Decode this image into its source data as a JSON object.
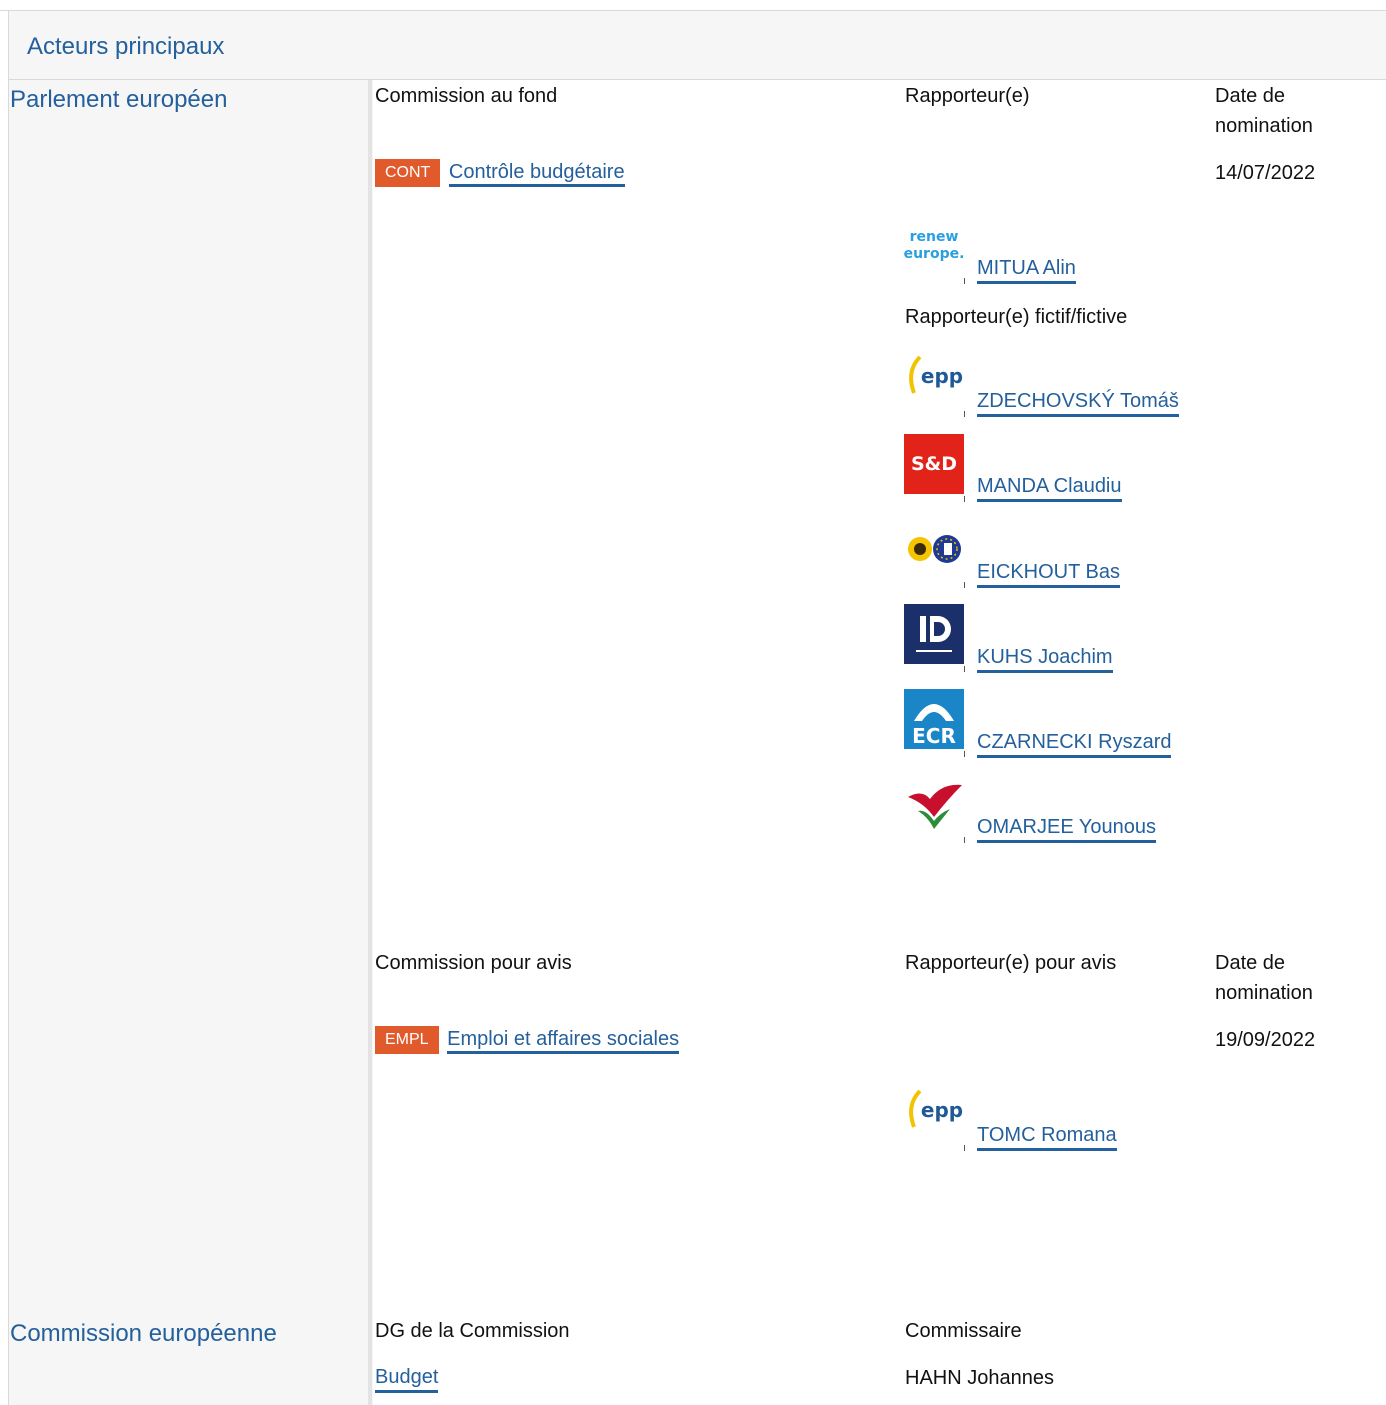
{
  "header": {
    "title": "Acteurs principaux"
  },
  "parliament": {
    "title": "Parlement européen",
    "lead": {
      "committee_header": "Commission au fond",
      "rapporteur_header": "Rapporteur(e)",
      "date_header_line1": "Date de",
      "date_header_line2": "nomination",
      "committee_code": "CONT",
      "committee_name": "Contrôle budgétaire",
      "date": "14/07/2022",
      "rapporteur": {
        "name": "MITUA Alin",
        "group_icon": "renew-europe-logo",
        "logo_text_1": "renew",
        "logo_text_2": "europe."
      },
      "shadow_header": "Rapporteur(e) fictif/fictive",
      "shadows": [
        {
          "name": "ZDECHOVSKÝ Tomáš",
          "group_icon": "epp-logo",
          "logo_text": "epp"
        },
        {
          "name": "MANDA Claudiu",
          "group_icon": "s-and-d-logo",
          "logo_text": "S&D"
        },
        {
          "name": "EICKHOUT Bas",
          "group_icon": "greens-efa-logo"
        },
        {
          "name": "KUHS Joachim",
          "group_icon": "identity-democracy-logo"
        },
        {
          "name": "CZARNECKI Ryszard",
          "group_icon": "ecr-logo",
          "logo_text": "ECR"
        },
        {
          "name": "OMARJEE Younous",
          "group_icon": "left-logo"
        }
      ]
    },
    "opinion": {
      "committee_header": "Commission pour avis",
      "rapporteur_header": "Rapporteur(e) pour avis",
      "date_header_line1": "Date de",
      "date_header_line2": "nomination",
      "committee_code": "EMPL",
      "committee_name": "Emploi et affaires sociales",
      "date": "19/09/2022",
      "rapporteur": {
        "name": "TOMC Romana",
        "group_icon": "epp-logo",
        "logo_text": "epp"
      }
    }
  },
  "commission": {
    "title": "Commission européenne",
    "dg_header": "DG de la Commission",
    "commissioner_header": "Commissaire",
    "dg_name": "Budget",
    "commissioner": "HAHN Johannes"
  },
  "colors": {
    "link": "#24609c",
    "badge": "#e05a2b",
    "panel": "#f6f6f6"
  }
}
